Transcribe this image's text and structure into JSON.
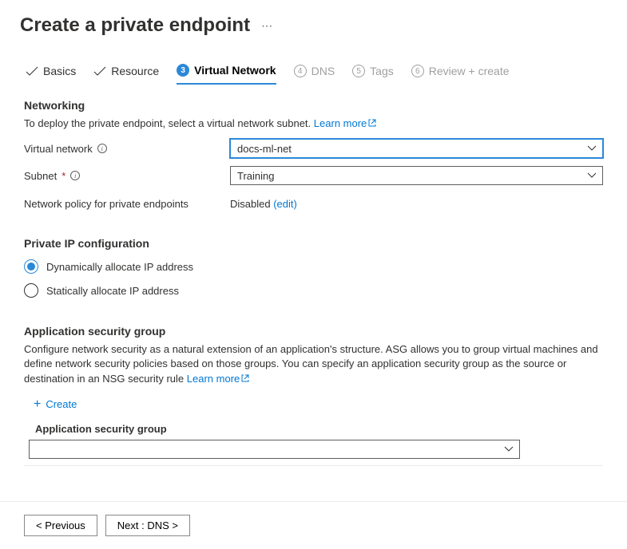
{
  "header": {
    "title": "Create a private endpoint"
  },
  "tabs": {
    "basics": "Basics",
    "resource": "Resource",
    "virtual_network": "Virtual Network",
    "virtual_network_num": "3",
    "dns": "DNS",
    "dns_num": "4",
    "tags": "Tags",
    "tags_num": "5",
    "review": "Review + create",
    "review_num": "6"
  },
  "networking": {
    "title": "Networking",
    "description": "To deploy the private endpoint, select a virtual network subnet.",
    "learn_more": "Learn more",
    "vnet_label": "Virtual network",
    "vnet_value": "docs-ml-net",
    "subnet_label": "Subnet",
    "subnet_value": "Training",
    "policy_label": "Network policy for private endpoints",
    "policy_value": "Disabled",
    "policy_edit": "(edit)"
  },
  "private_ip": {
    "title": "Private IP configuration",
    "dynamic": "Dynamically allocate IP address",
    "static": "Statically allocate IP address"
  },
  "asg": {
    "title": "Application security group",
    "description": "Configure network security as a natural extension of an application's structure. ASG allows you to group virtual machines and define network security policies based on those groups. You can specify an application security group as the source or destination in an NSG security rule",
    "learn_more": "Learn more",
    "create": "Create",
    "column_header": "Application security group"
  },
  "footer": {
    "previous": "< Previous",
    "next": "Next : DNS >"
  }
}
